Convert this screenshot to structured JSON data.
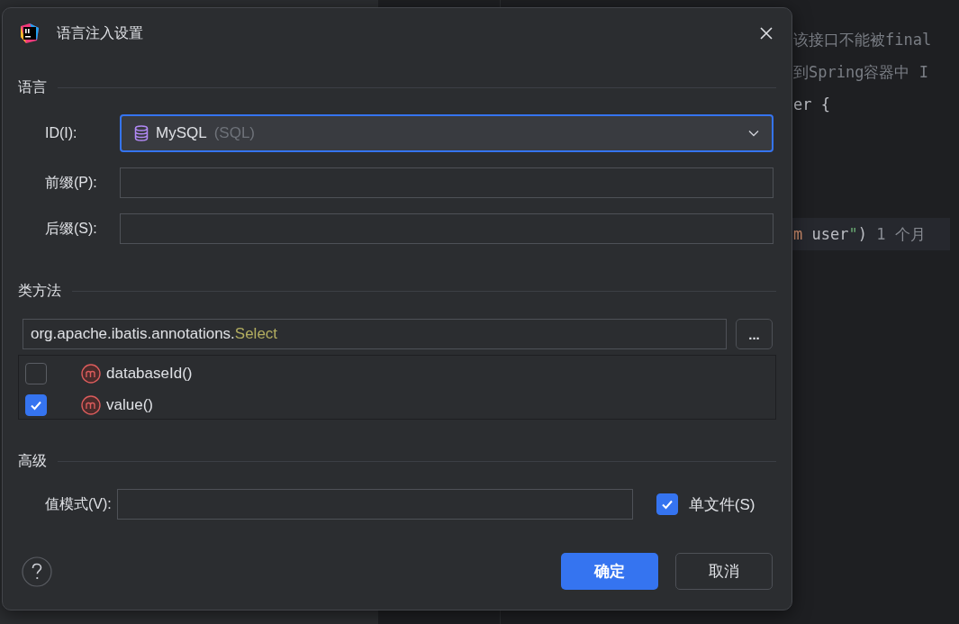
{
  "editor": {
    "lines": [
      {
        "segments": [
          {
            "kind": "comment",
            "text": "该接口不能被final"
          }
        ],
        "highlighted": false
      },
      {
        "segments": [
          {
            "kind": "comment",
            "text": "到Spring容器中 I"
          }
        ],
        "highlighted": false
      },
      {
        "segments": [
          {
            "kind": "plain",
            "text": "er {"
          }
        ],
        "highlighted": false
      },
      {
        "highlighted": false
      },
      {
        "highlighted": false
      },
      {
        "highlighted": false
      },
      {
        "segments": [
          {
            "kind": "keyword",
            "text": "m"
          },
          {
            "kind": "plain",
            "text": " user"
          },
          {
            "kind": "string",
            "text": "\""
          },
          {
            "kind": "plain",
            "text": ")"
          },
          {
            "kind": "hint",
            "text": "  1 个月"
          }
        ],
        "highlighted": true
      }
    ]
  },
  "dialog": {
    "title": "语言注入设置",
    "language": {
      "heading": "语言",
      "id": {
        "label": "ID(I):",
        "value": "MySQL",
        "detail": "(SQL)",
        "focused": true
      },
      "prefix": {
        "label": "前缀(P):"
      },
      "suffix": {
        "label": "后缀(S):"
      }
    },
    "class_methods": {
      "heading": "类方法",
      "class_name": {
        "prefix": "org.apache.ibatis.annotations.",
        "name": "Select"
      },
      "browse_button": "...",
      "methods": [
        {
          "name": "databaseId()",
          "checked": false
        },
        {
          "name": "value()",
          "checked": true
        }
      ]
    },
    "advanced": {
      "heading": "高级",
      "value_pattern": {
        "label": "值模式(V):"
      },
      "single_file": {
        "label": "单文件(S)",
        "checked": true
      }
    },
    "buttons": [
      {
        "label": "确定",
        "kind": "primary"
      },
      {
        "label": "取消",
        "kind": "secondary"
      }
    ]
  }
}
